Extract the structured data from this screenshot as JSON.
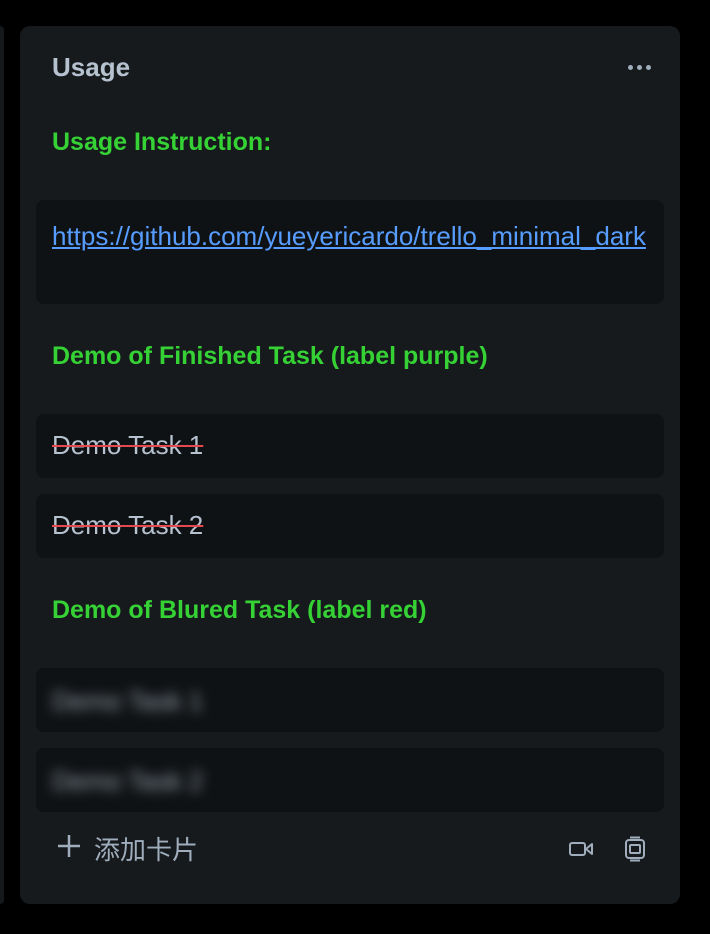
{
  "list": {
    "title": "Usage",
    "more_icon": "more-horizontal-icon"
  },
  "sections": {
    "usage_heading": "Usage Instruction:",
    "link_url": "https://github.com/yueyericardo/trello_minimal_dark",
    "finished_heading": "Demo of Finished Task (label purple)",
    "finished_tasks": [
      "Demo Task 1",
      "Demo Task 2"
    ],
    "blurred_heading": "Demo of Blured Task (label red)",
    "blurred_tasks": [
      "Demo Task 1",
      "Demo Task 2"
    ]
  },
  "footer": {
    "add_card_label": "添加卡片",
    "add_icon": "plus-icon",
    "video_icon": "video-camera-icon",
    "template_icon": "card-template-icon"
  },
  "colors": {
    "background": "#000000",
    "list_bg": "#161a1d",
    "card_bg": "#0f1214",
    "heading_green": "#35d135",
    "link_blue": "#579dff",
    "text": "#b6c2cf",
    "muted": "#9fadbc",
    "strike_red": "#e5484d"
  }
}
